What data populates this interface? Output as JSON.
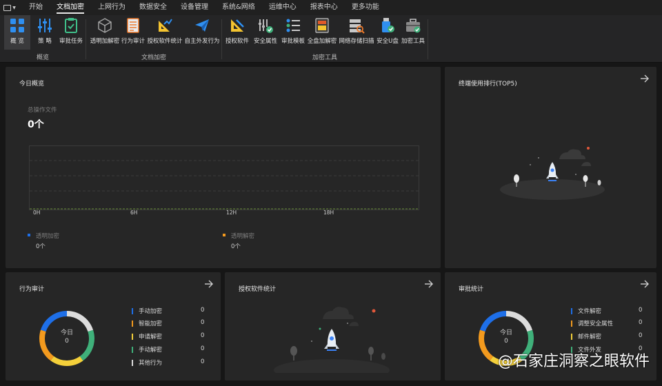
{
  "menubar": {
    "items": [
      {
        "label": "开始"
      },
      {
        "label": "文档加密",
        "active": true
      },
      {
        "label": "上网行为"
      },
      {
        "label": "数据安全"
      },
      {
        "label": "设备管理"
      },
      {
        "label": "系统&网络"
      },
      {
        "label": "运维中心"
      },
      {
        "label": "报表中心"
      },
      {
        "label": "更多功能"
      }
    ]
  },
  "ribbon": {
    "groups": [
      {
        "label": "概览",
        "tools": [
          {
            "label": "概 览",
            "icon": "grid-icon",
            "selected": true
          },
          {
            "label": "策 略",
            "icon": "sliders-icon"
          },
          {
            "label": "审批任务",
            "icon": "checklist-icon"
          }
        ]
      },
      {
        "label": "文档加密",
        "tools": [
          {
            "label": "透明加解密",
            "icon": "cube-icon"
          },
          {
            "label": "行为审计",
            "icon": "document-list-icon"
          },
          {
            "label": "授权软件统计",
            "icon": "ruler-chart-icon"
          },
          {
            "label": "自主外发行为",
            "icon": "paper-plane-icon"
          }
        ]
      },
      {
        "label": "加密工具",
        "tools": [
          {
            "label": "授权软件",
            "icon": "ruler-icon"
          },
          {
            "label": "安全属性",
            "icon": "properties-shield-icon"
          },
          {
            "label": "审批模板",
            "icon": "template-list-icon"
          },
          {
            "label": "全盘加解密",
            "icon": "disk-encrypt-icon"
          },
          {
            "label": "网络存储扫描",
            "icon": "server-scan-icon"
          },
          {
            "label": "安全U盘",
            "icon": "usb-shield-icon"
          },
          {
            "label": "加密工具",
            "icon": "toolbox-icon"
          }
        ]
      }
    ]
  },
  "today_overview": {
    "title": "今日概览",
    "metric_label": "总操作文件",
    "metric_value": "0个",
    "chart_data": {
      "type": "line",
      "x": [
        "0H",
        "6H",
        "12H",
        "18H"
      ],
      "series": [
        {
          "name": "透明加密",
          "values": [
            0,
            0,
            0,
            0
          ],
          "color": "#1e6fe8"
        },
        {
          "name": "透明解密",
          "values": [
            0,
            0,
            0,
            0
          ],
          "color": "#f39a1e"
        }
      ]
    },
    "legend": [
      {
        "name": "透明加密",
        "value": "0个",
        "color": "#1e6fe8"
      },
      {
        "name": "透明解密",
        "value": "0个",
        "color": "#f39a1e"
      }
    ]
  },
  "terminal_rank": {
    "title": "终端使用排行(TOP5)"
  },
  "behavior_audit": {
    "title": "行为审计",
    "center_label": "今日",
    "center_value": "0",
    "rows": [
      {
        "name": "手动加密",
        "value": "0",
        "color": "#1e6fe8"
      },
      {
        "name": "智能加密",
        "value": "0",
        "color": "#f39a1e"
      },
      {
        "name": "申请解密",
        "value": "0",
        "color": "#f4d03a"
      },
      {
        "name": "手动解密",
        "value": "0",
        "color": "#3fb07a"
      },
      {
        "name": "其他行为",
        "value": "0",
        "color": "#dcdcdc"
      }
    ]
  },
  "authorized_software": {
    "title": "授权软件统计"
  },
  "approval_stats": {
    "title": "审批统计",
    "center_label": "今日",
    "center_value": "0",
    "rows": [
      {
        "name": "文件解密",
        "value": "0",
        "color": "#1e6fe8"
      },
      {
        "name": "调整安全属性",
        "value": "0",
        "color": "#f39a1e"
      },
      {
        "name": "邮件解密",
        "value": "0",
        "color": "#f4d03a"
      },
      {
        "name": "文件外发",
        "value": "0",
        "color": "#3fb07a"
      }
    ]
  },
  "watermark": {
    "text": "@石家庄洞察之眼软件"
  }
}
